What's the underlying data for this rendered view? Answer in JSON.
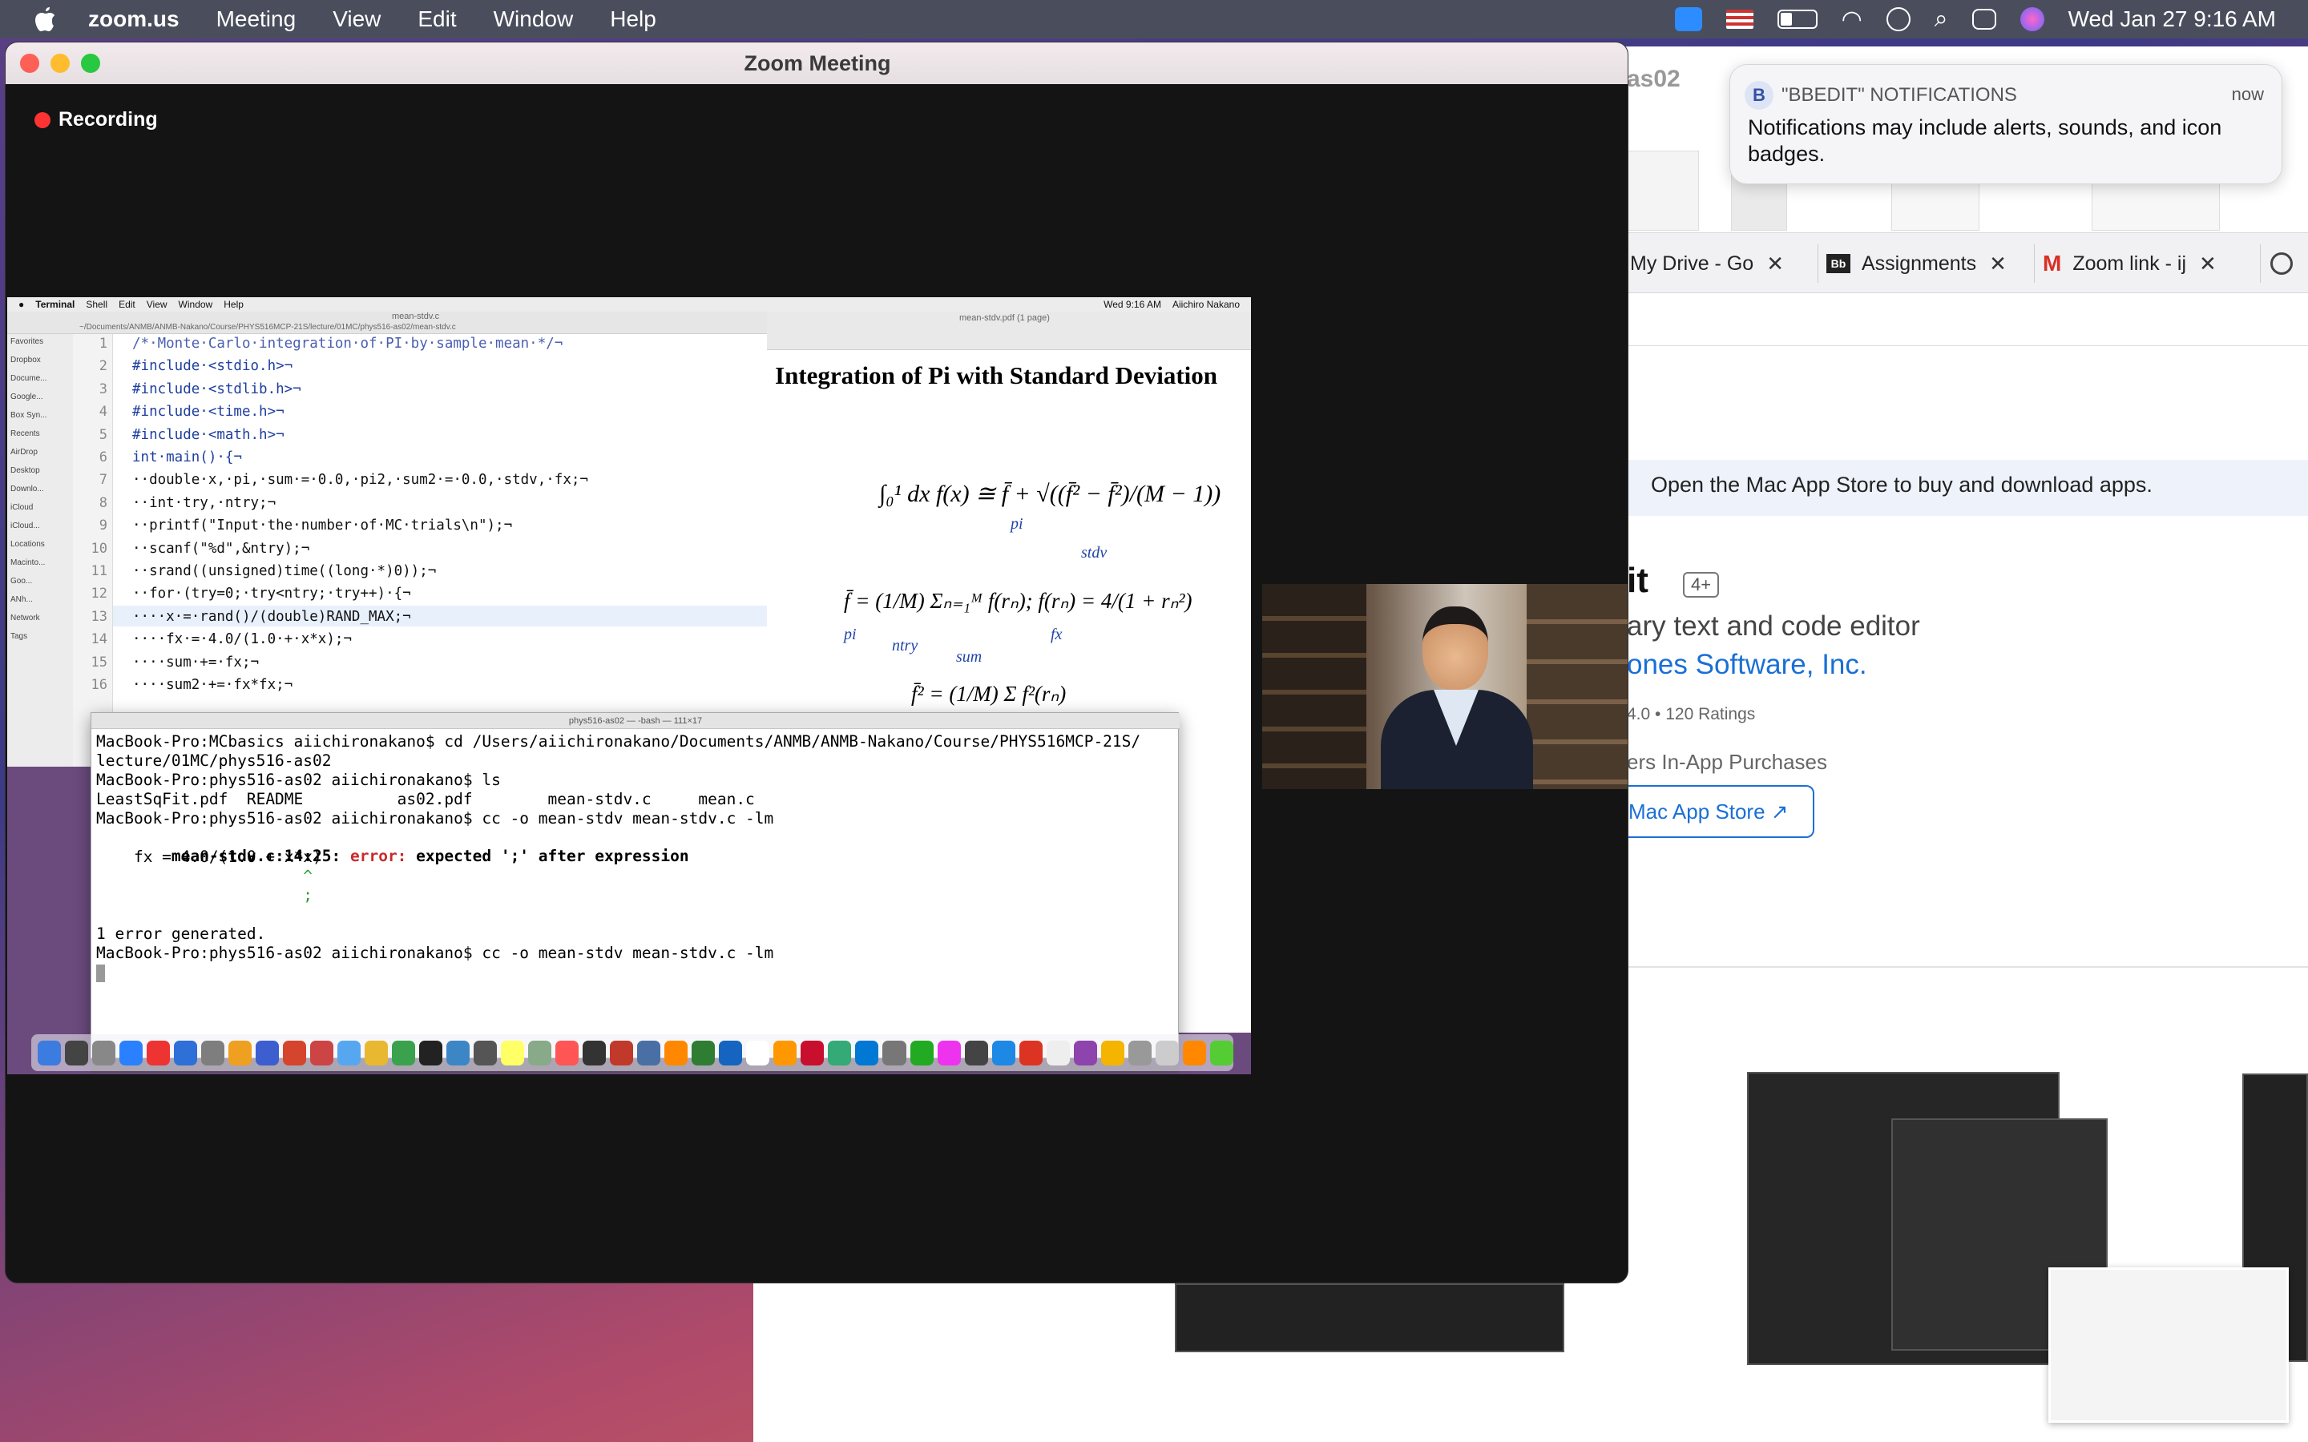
{
  "menubar": {
    "app_name": "zoom.us",
    "items": [
      "Meeting",
      "View",
      "Edit",
      "Window",
      "Help"
    ],
    "datetime": "Wed Jan 27  9:16 AM"
  },
  "zoom": {
    "window_title": "Zoom Meeting",
    "recording_label": "Recording"
  },
  "notification": {
    "app": "\"BBEDIT\" NOTIFICATIONS",
    "time": "now",
    "body": "Notifications may include alerts, sounds, and icon badges."
  },
  "background_app": {
    "partial_title": "as02",
    "tabs": [
      {
        "label": "My Drive - Go",
        "icon": "drive-icon"
      },
      {
        "label": "Assignments",
        "icon": "bb-icon"
      },
      {
        "label": "Zoom link - ij",
        "icon": "gmail-icon"
      }
    ],
    "banner": "Open the Mac App Store to buy and download apps.",
    "app_name_fragment": "it",
    "age_rating": "4+",
    "subtitle_fragment": "ary text and code editor",
    "developer_fragment": "ones Software, Inc.",
    "rating_fragment": "4.0 • 120 Ratings",
    "iap_fragment": "ers In-App Purchases",
    "store_button": "Mac App Store ↗"
  },
  "shared_screen": {
    "menubar": {
      "app": "Terminal",
      "items": [
        "Shell",
        "Edit",
        "View",
        "Window",
        "Help"
      ],
      "clock": "Wed 9:16 AM",
      "user": "Aiichiro Nakano"
    },
    "editor": {
      "filename": "mean-stdv.c",
      "path": "~/Documents/ANMB/ANMB-Nakano/Course/PHYS516MCP-21S/lecture/01MC/phys516-as02/mean-stdv.c",
      "sidebar": [
        "Favorites",
        "Dropbox",
        "Docume...",
        "Google...",
        "Box Syn...",
        "Recents",
        "AirDrop",
        "Desktop",
        "Downlo...",
        "iCloud",
        "iCloud...",
        "Locations",
        "Macinto...",
        "Goo...",
        "ANh...",
        "Network",
        "Tags"
      ],
      "lines": [
        "/*·Monte·Carlo·integration·of·PI·by·sample·mean·*/¬",
        "#include·<stdio.h>¬",
        "#include·<stdlib.h>¬",
        "#include·<time.h>¬",
        "#include·<math.h>¬",
        "int·main()·{¬",
        "··double·x,·pi,·sum·=·0.0,·pi2,·sum2·=·0.0,·stdv,·fx;¬",
        "··int·try,·ntry;¬",
        "··printf(\"Input·the·number·of·MC·trials\\n\");¬",
        "··scanf(\"%d\",&ntry);¬",
        "··srand((unsigned)time((long·*)0));¬",
        "··for·(try=0;·try<ntry;·try++)·{¬",
        "····x·=·rand()/(double)RAND_MAX;¬",
        "····fx·=·4.0/(1.0·+·x*x);¬",
        "····sum·+=·fx;¬",
        "····sum2·+=·fx*fx;¬"
      ],
      "line_numbers": [
        "1",
        "2",
        "3",
        "4",
        "5",
        "6",
        "7",
        "8",
        "9",
        "10",
        "11",
        "12",
        "13",
        "14",
        "15",
        "16"
      ]
    },
    "pdf": {
      "filename": "mean-stdv.pdf (1 page)",
      "title": "Integration of Pi with Standard Deviation",
      "eq1": "∫₀¹ dx f(x) ≅ f̄ + √((f̄² − f̄²)/(M − 1))",
      "eq1_pi": "pi",
      "eq1_stdv": "stdv",
      "eq2": "f̄ = (1/M) Σₙ₌₁ᴹ f(rₙ);  f(rₙ) = 4/(1 + rₙ²)",
      "eq2_pi": "pi",
      "eq2_ntry": "ntry",
      "eq2_sum": "sum",
      "eq2_fx": "fx",
      "eq3": "f̄² = (1/M) Σ f²(rₙ)"
    },
    "terminal": {
      "title": "phys516-as02 — -bash — 111×17",
      "lines": [
        "MacBook-Pro:MCbasics aiichironakano$ cd /Users/aiichironakano/Documents/ANMB/ANMB-Nakano/Course/PHYS516MCP-21S/",
        "lecture/01MC/phys516-as02",
        "MacBook-Pro:phys516-as02 aiichironakano$ ls",
        "LeastSqFit.pdf  README          as02.pdf        mean-stdv.c     mean.c",
        "MacBook-Pro:phys516-as02 aiichironakano$ cc -o mean-stdv mean-stdv.c -lm",
        "",
        "    fx = 4.0/(1.0 + x*x)",
        "                      ^",
        "                      ;",
        "1 error generated.",
        "MacBook-Pro:phys516-as02 aiichironakano$ cc -o mean-stdv mean-stdv.c -lm"
      ],
      "error_loc": "mean-stdv.c:14:25: ",
      "error_word": "error: ",
      "error_msg": "expected ';' after expression"
    }
  },
  "colors": {
    "menubar_bg": "#4a4e5c",
    "zoom_bg": "#141414",
    "recording_dot": "#ff3333",
    "link_blue": "#1a6fd6"
  }
}
